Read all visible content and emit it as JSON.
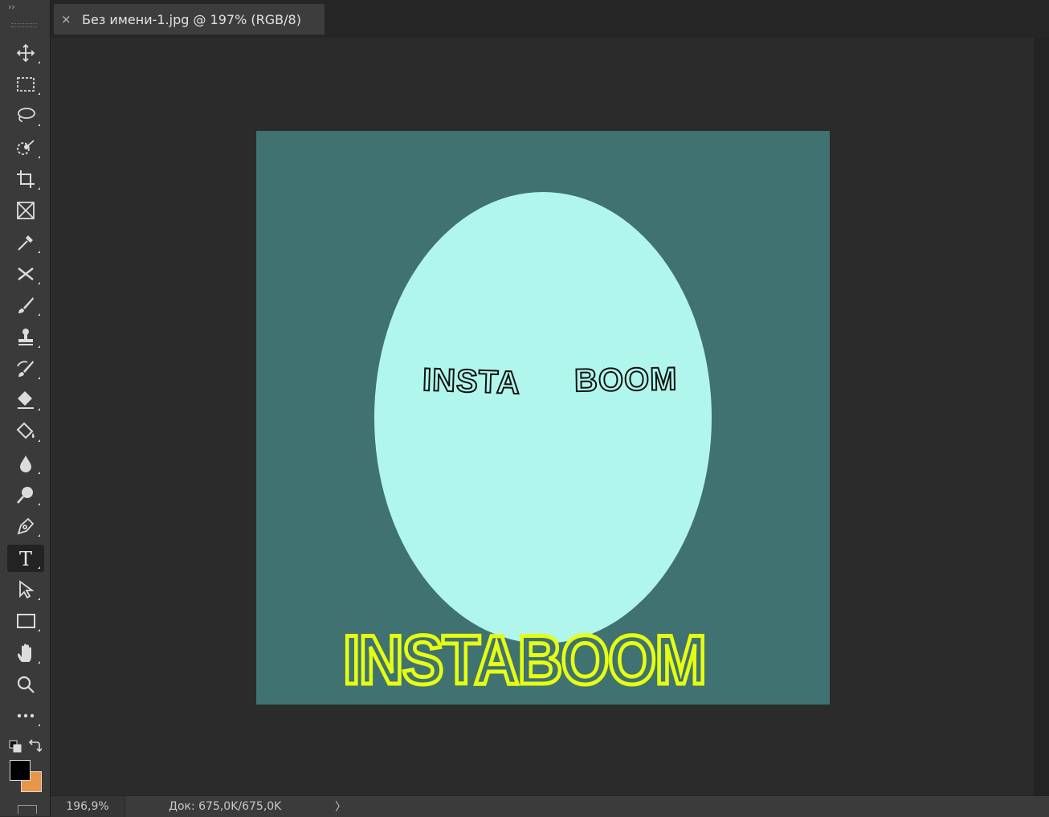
{
  "window": {
    "tab_title": "Без имени-1.jpg @ 197% (RGB/8)",
    "tab_close": "×",
    "collapse_glyph": "››"
  },
  "toolbar": {
    "active_tool": "type-tool",
    "tools": [
      {
        "name": "move-tool",
        "icon": "move-icon"
      },
      {
        "name": "rectangular-marquee-tool",
        "icon": "marquee-icon"
      },
      {
        "name": "lasso-tool",
        "icon": "lasso-icon"
      },
      {
        "name": "quick-selection-tool",
        "icon": "quick-selection-icon"
      },
      {
        "name": "crop-tool",
        "icon": "crop-icon"
      },
      {
        "name": "frame-tool",
        "icon": "frame-icon"
      },
      {
        "name": "eyedropper-tool",
        "icon": "eyedropper-icon"
      },
      {
        "name": "healing-brush-tool",
        "icon": "healing-icon"
      },
      {
        "name": "brush-tool",
        "icon": "brush-icon"
      },
      {
        "name": "clone-stamp-tool",
        "icon": "stamp-icon"
      },
      {
        "name": "history-brush-tool",
        "icon": "history-brush-icon"
      },
      {
        "name": "eraser-tool",
        "icon": "eraser-icon"
      },
      {
        "name": "paint-bucket-tool",
        "icon": "paint-bucket-icon"
      },
      {
        "name": "blur-tool",
        "icon": "blur-drop-icon"
      },
      {
        "name": "dodge-tool",
        "icon": "dodge-icon"
      },
      {
        "name": "pen-tool",
        "icon": "pen-icon"
      },
      {
        "name": "type-tool",
        "icon": "type-icon"
      },
      {
        "name": "path-selection-tool",
        "icon": "path-selection-icon"
      },
      {
        "name": "rectangle-tool",
        "icon": "rectangle-icon"
      },
      {
        "name": "hand-tool",
        "icon": "hand-icon"
      },
      {
        "name": "zoom-tool",
        "icon": "zoom-icon"
      },
      {
        "name": "edit-toolbar",
        "icon": "more-icon"
      }
    ],
    "foreground_color": "#000000",
    "background_color": "#e8954a"
  },
  "canvas": {
    "background_color": "#3f7270",
    "oval_color": "#b1f6ec",
    "text_insta": "INSTA",
    "text_boom": "BOOM",
    "text_instaboom": "INSTABOOM",
    "headline_color": "#e6ff10"
  },
  "status": {
    "zoom": "196,9%",
    "doc_info": "Док: 675,0K/675,0K",
    "arrow": "〉"
  }
}
